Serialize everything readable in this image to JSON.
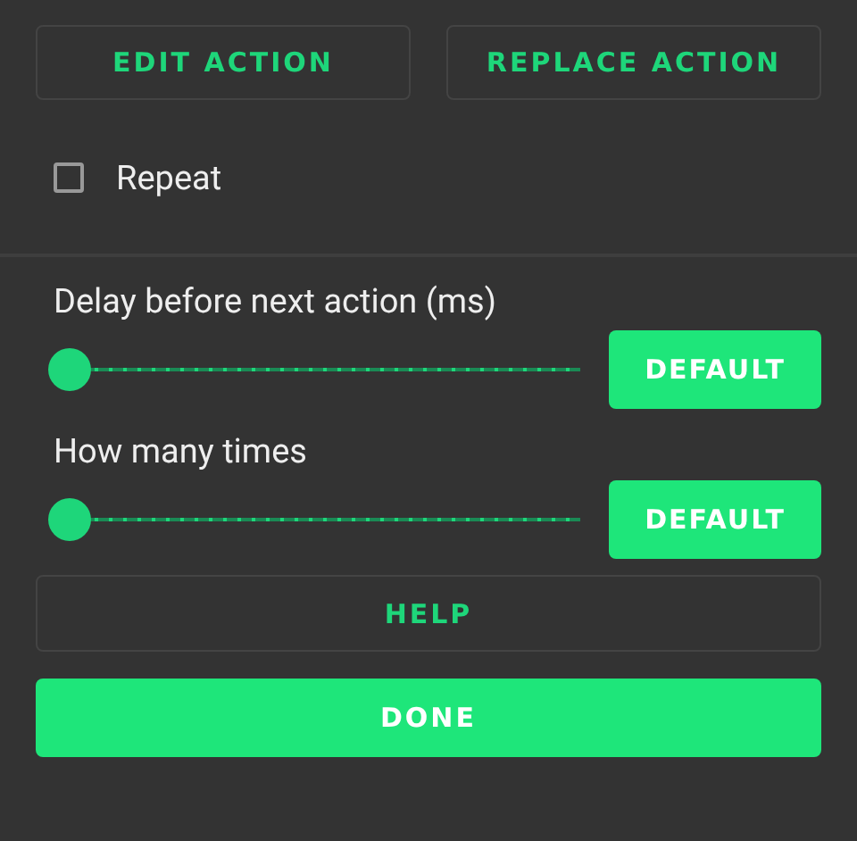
{
  "top_buttons": [
    "EDIT ACTION",
    "REPLACE ACTION"
  ],
  "repeat": {
    "label": "Repeat",
    "checked": false
  },
  "sliders": [
    {
      "label": "Delay before next action (ms)",
      "level": 0,
      "button": "DEFAULT"
    },
    {
      "label": "How many times",
      "level": 0,
      "button": "DEFAULT"
    }
  ],
  "help_button": "HELP",
  "done_button": "DONE"
}
